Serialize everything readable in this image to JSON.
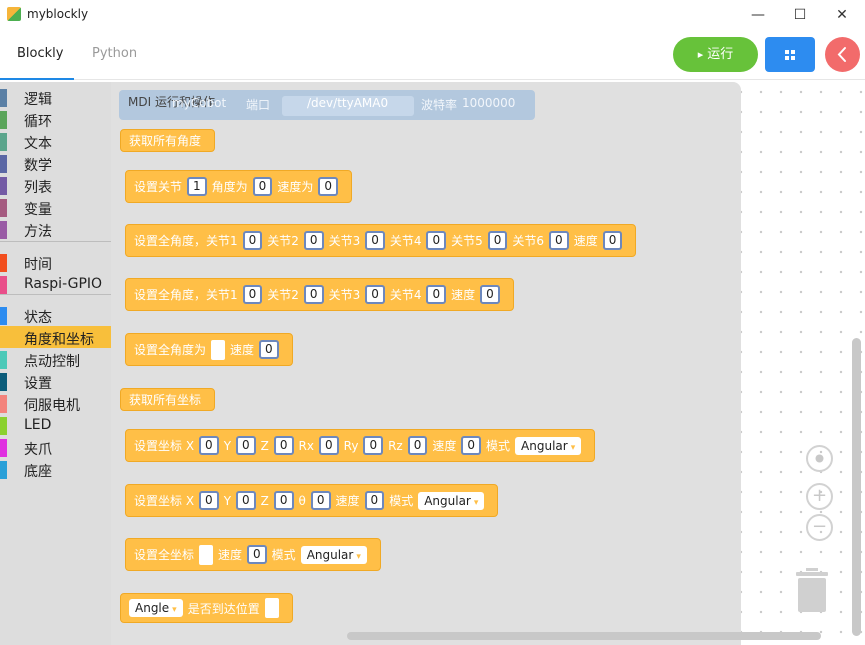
{
  "window": {
    "title": "myblockly",
    "minimize": "—",
    "maximize": "☐",
    "close": "✕"
  },
  "tabs": [
    {
      "label": "Blockly"
    },
    {
      "label": "Python"
    }
  ],
  "toolbar": {
    "run_label": "运行",
    "run_icon": "▸"
  },
  "toolbox": {
    "items": [
      {
        "label": "逻辑",
        "color": "#5b80a5"
      },
      {
        "label": "循环",
        "color": "#5ba55b"
      },
      {
        "label": "文本",
        "color": "#5ba58c"
      },
      {
        "label": "数学",
        "color": "#5b67a5"
      },
      {
        "label": "列表",
        "color": "#745ba5"
      },
      {
        "label": "变量",
        "color": "#a55b80"
      },
      {
        "label": "方法",
        "color": "#995ba5"
      },
      {
        "label": "时间",
        "color": "#f24e1e"
      },
      {
        "label": "Raspi-GPIO",
        "color": "#e94f8a"
      },
      {
        "label": "状态",
        "color": "#2d8cf0"
      },
      {
        "label": "角度和坐标",
        "color": "#f8bf3b"
      },
      {
        "label": "点动控制",
        "color": "#4cc9b8"
      },
      {
        "label": "设置",
        "color": "#0b5c7a"
      },
      {
        "label": "伺服电机",
        "color": "#f3837c"
      },
      {
        "label": "LED",
        "color": "#8bd12f"
      },
      {
        "label": "夹爪",
        "color": "#e030e0"
      },
      {
        "label": "底座",
        "color": "#2aa0d8"
      }
    ]
  },
  "mdi": {
    "title": "MDI 运行和操作",
    "robot": "myCobot",
    "port_label": "端口",
    "port_value": "/dev/ttyAMA0",
    "baud_label": "波特率",
    "baud_value": "1000000"
  },
  "blocks": {
    "b1": {
      "t0": "获取所有角度"
    },
    "b2": {
      "t0": "设置关节",
      "v0": "1",
      "t1": "角度为",
      "v1": "0",
      "t2": "速度为",
      "v2": "0"
    },
    "b3": {
      "t0": "设置全角度，关节1",
      "v0": "0",
      "t1": "关节2",
      "v1": "0",
      "t2": "关节3",
      "v2": "0",
      "t3": "关节4",
      "v3": "0",
      "t4": "关节5",
      "v4": "0",
      "t5": "关节6",
      "v5": "0",
      "t6": "速度",
      "v6": "0"
    },
    "b4": {
      "t0": "设置全角度，关节1",
      "v0": "0",
      "t1": "关节2",
      "v1": "0",
      "t2": "关节3",
      "v2": "0",
      "t3": "关节4",
      "v3": "0",
      "t4": "速度",
      "v4": "0"
    },
    "b5": {
      "t0": "设置全角度为",
      "t1": "速度",
      "v1": "0"
    },
    "b6": {
      "t0": "获取所有坐标"
    },
    "b7": {
      "t0": "设置坐标 X",
      "v0": "0",
      "t1": "Y",
      "v1": "0",
      "t2": "Z",
      "v2": "0",
      "t3": "Rx",
      "v3": "0",
      "t4": "Ry",
      "v4": "0",
      "t5": "Rz",
      "v5": "0",
      "t6": "速度",
      "v6": "0",
      "t7": "模式",
      "mode": "Angular"
    },
    "b8": {
      "t0": "设置坐标 X",
      "v0": "0",
      "t1": "Y",
      "v1": "0",
      "t2": "Z",
      "v2": "0",
      "t3": "θ",
      "v3": "0",
      "t4": "速度",
      "v4": "0",
      "t5": "模式",
      "mode": "Angular"
    },
    "b9": {
      "t0": "设置全坐标",
      "t1": "速度",
      "v1": "0",
      "t2": "模式",
      "mode": "Angular"
    },
    "b10": {
      "sel": "Angle",
      "t0": "是否到达位置"
    }
  }
}
